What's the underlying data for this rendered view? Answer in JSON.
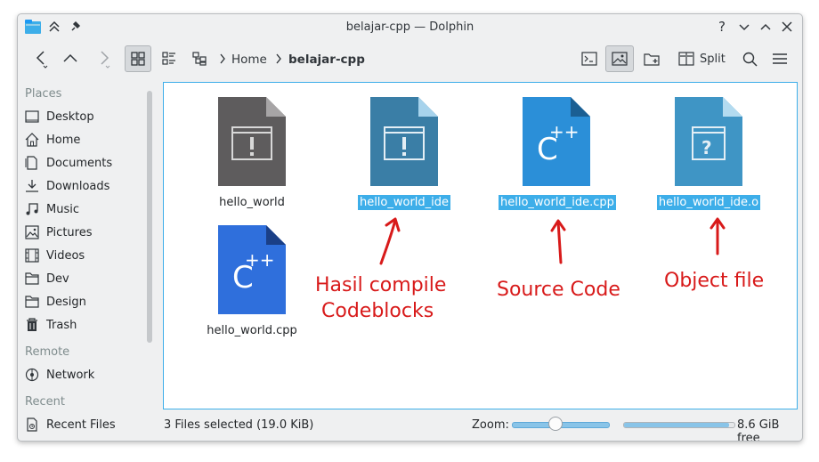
{
  "window": {
    "title": "belajar-cpp — Dolphin"
  },
  "toolbar": {
    "breadcrumb": [
      "Home",
      "belajar-cpp"
    ],
    "split_label": "Split"
  },
  "sidebar": {
    "places_heading": "Places",
    "places": [
      {
        "label": "Desktop",
        "icon": "desktop-icon"
      },
      {
        "label": "Home",
        "icon": "home-icon"
      },
      {
        "label": "Documents",
        "icon": "documents-icon"
      },
      {
        "label": "Downloads",
        "icon": "downloads-icon"
      },
      {
        "label": "Music",
        "icon": "music-icon"
      },
      {
        "label": "Pictures",
        "icon": "pictures-icon"
      },
      {
        "label": "Videos",
        "icon": "videos-icon"
      },
      {
        "label": "Dev",
        "icon": "folder-icon"
      },
      {
        "label": "Design",
        "icon": "folder-icon"
      },
      {
        "label": "Trash",
        "icon": "trash-icon"
      }
    ],
    "remote_heading": "Remote",
    "remote": [
      {
        "label": "Network",
        "icon": "network-icon"
      }
    ],
    "recent_heading": "Recent",
    "recent": [
      {
        "label": "Recent Files",
        "icon": "recent-files-icon"
      }
    ]
  },
  "files": [
    {
      "name": "hello_world",
      "icon": "executable-icon",
      "selected": false
    },
    {
      "name": "hello_world_ide",
      "icon": "executable-icon",
      "selected": true
    },
    {
      "name": "hello_world_ide.cpp",
      "icon": "cpp-source-icon",
      "selected": true
    },
    {
      "name": "hello_world_ide.o",
      "icon": "object-file-icon",
      "selected": true
    },
    {
      "name": "hello_world.cpp",
      "icon": "cpp-source-icon",
      "selected": false
    }
  ],
  "annotations": {
    "ide_line1": "Hasil compile",
    "ide_line2": "Codeblocks",
    "cpp": "Source Code",
    "obj": "Object file"
  },
  "status": {
    "selection": "3 Files selected (19.0 KiB)",
    "zoom_label": "Zoom:",
    "zoom_level": 0.45,
    "free_space": "8.6 GiB free",
    "free_space_used_fraction": 0.95
  },
  "colors": {
    "accent": "#3daee9",
    "annotation": "#d81a1a"
  }
}
